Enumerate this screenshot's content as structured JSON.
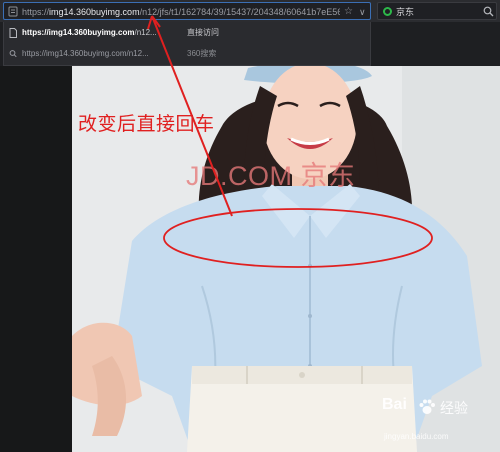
{
  "address_bar": {
    "url_prefix": "https://",
    "url_host": "img14.360buyimg.com",
    "url_path": "/n12/jfs/t1/162784/39/15437/204348/60641b7eE56",
    "star_icon": "star-icon",
    "dropdown_icon": "chevron-down-icon"
  },
  "search_box": {
    "query": "京东",
    "engine_icon": "360-search-logo-icon",
    "search_icon": "search-icon"
  },
  "suggestions": [
    {
      "bold": "https://img14.360buyimg.com",
      "rest": "/n12...",
      "action": "直接访问",
      "icon": "page-icon"
    },
    {
      "bold": "",
      "rest": "https://img14.360buyimg.com/n12...",
      "action": "360搜索",
      "icon": "search-icon"
    }
  ],
  "annotation": {
    "text": "改变后直接回车",
    "color": "#e02020"
  },
  "watermark": {
    "text": "JD.COM 京东"
  },
  "brand": {
    "name": "Bai",
    "suffix": "经验",
    "domain": "jingyan.baidu.com"
  }
}
